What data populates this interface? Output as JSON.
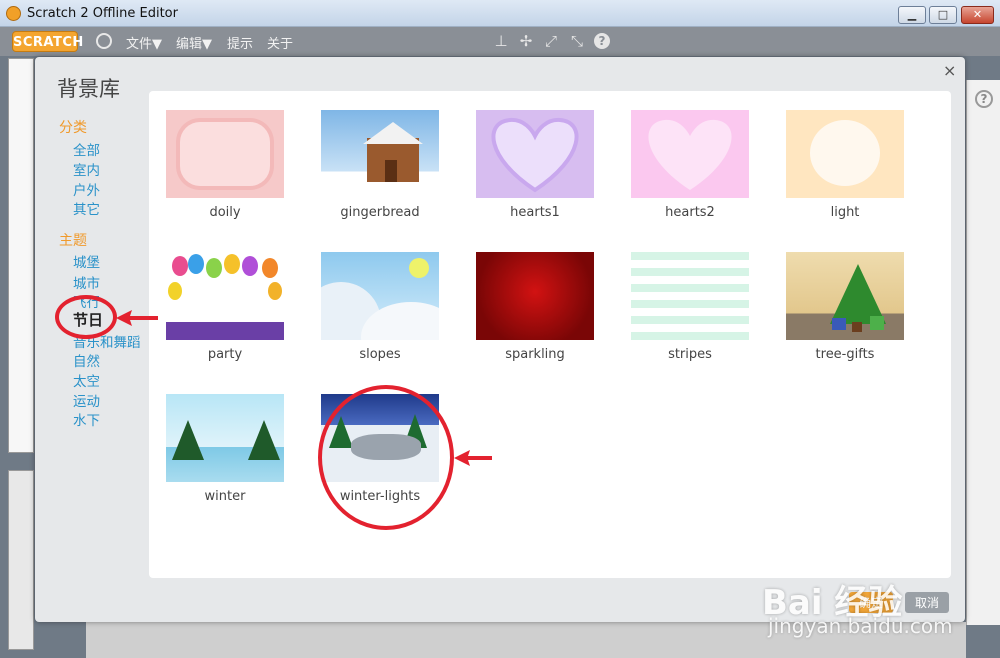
{
  "window": {
    "title": "Scratch 2 Offline Editor",
    "min": "▁",
    "max": "□",
    "close": "✕"
  },
  "menubar": {
    "logo": "SCRATCH",
    "items": [
      "文件▼",
      "编辑▼",
      "提示",
      "关于"
    ],
    "tool_icons": [
      "stamp-icon",
      "cut-icon",
      "grow-icon",
      "shrink-icon",
      "help-icon"
    ]
  },
  "modal": {
    "title": "背景库",
    "close": "×",
    "category_header": "分类",
    "categories": [
      "全部",
      "室内",
      "户外",
      "其它"
    ],
    "theme_header": "主题",
    "themes": [
      "城堡",
      "城市",
      "飞行",
      "节日",
      "音乐和舞蹈",
      "自然",
      "太空",
      "运动",
      "水下"
    ],
    "selected_theme": "节日",
    "ok_label": "确定",
    "cancel_label": "取消"
  },
  "backdrops": [
    {
      "name": "doily"
    },
    {
      "name": "gingerbread"
    },
    {
      "name": "hearts1"
    },
    {
      "name": "hearts2"
    },
    {
      "name": "light"
    },
    {
      "name": "party"
    },
    {
      "name": "slopes"
    },
    {
      "name": "sparkling"
    },
    {
      "name": "stripes"
    },
    {
      "name": "tree-gifts"
    },
    {
      "name": "winter"
    },
    {
      "name": "winter-lights"
    }
  ],
  "help_badge": "?",
  "watermark": {
    "main": "Bai 经验",
    "sub": "jingyan.baidu.com"
  },
  "colors": {
    "accent_orange": "#f09a2c",
    "link_blue": "#2a92c9",
    "annotation_red": "#e3222f"
  }
}
